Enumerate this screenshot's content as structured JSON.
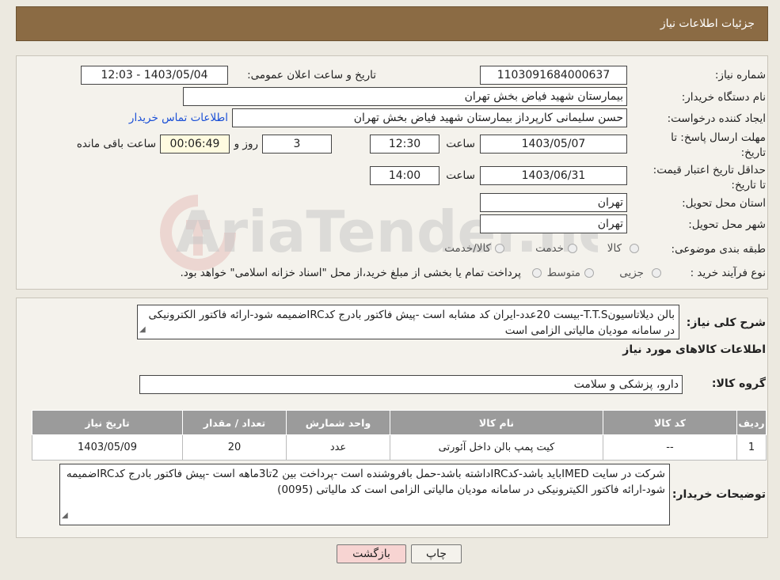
{
  "header": {
    "title": "جزئیات اطلاعات نیاز"
  },
  "form": {
    "need_number_label": "شماره نیاز:",
    "need_number": "1103091684000637",
    "announce_label": "تاریخ و ساعت اعلان عمومی:",
    "announce_value": "1403/05/04 - 12:03",
    "buyer_label": "نام دستگاه خریدار:",
    "buyer_value": "بیمارستان شهید فیاض بخش تهران",
    "creator_label": "ایجاد کننده درخواست:",
    "creator_value": "حسن سلیمانی کارپرداز بیمارستان شهید فیاض بخش تهران",
    "contact_link": "اطلاعات تماس خریدار",
    "deadline_label": "مهلت ارسال پاسخ: تا تاریخ:",
    "deadline_date": "1403/05/07",
    "time_label": "ساعت",
    "deadline_time": "12:30",
    "days_value": "3",
    "days_label": "روز و",
    "timer_value": "00:06:49",
    "remaining_label": "ساعت باقی مانده",
    "validity_label": "حداقل تاریخ اعتبار قیمت: تا تاریخ:",
    "validity_date": "1403/06/31",
    "validity_time": "14:00",
    "province_label": "استان محل تحویل:",
    "province_value": "تهران",
    "city_label": "شهر محل تحویل:",
    "city_value": "تهران",
    "category_label": "طبقه بندی موضوعی:",
    "category_options": [
      "کالا",
      "خدمت",
      "کالا/خدمت"
    ],
    "process_label": "نوع فرآیند خرید :",
    "process_options": [
      "جزیی",
      "متوسط"
    ],
    "payment_note": "پرداخت تمام یا بخشی از مبلغ خرید،از محل \"اسناد خزانه اسلامی\" خواهد بود."
  },
  "description": {
    "label": "شرح کلی نیاز:",
    "text": "بالن دیلاتاسیونT.T.S-بیست 20عدد-ایران کد مشابه است -پیش فاکتور بادرج کدIRCضمیمه شود-ارائه فاکتور الکترونیکی در سامانه مودیان مالیاتی الزامی است"
  },
  "goods": {
    "section_title": "اطلاعات کالاهای مورد نیاز",
    "group_label": "گروه کالا:",
    "group_value": "دارو، پزشکی و سلامت",
    "columns": [
      "ردیف",
      "کد کالا",
      "نام کالا",
      "واحد شمارش",
      "تعداد / مقدار",
      "تاریخ نیاز"
    ],
    "rows": [
      {
        "row": "1",
        "code": "--",
        "name": "کیت پمپ بالن داخل آئورتی",
        "unit": "عدد",
        "qty": "20",
        "date": "1403/05/09"
      }
    ]
  },
  "buyer_notes": {
    "label": "توضیحات خریدار:",
    "text": "شرکت در سایت IMEDباید باشد-کدIRCداشته باشد-حمل بافروشنده است -پرداخت بین 2تا3ماهه است -پیش فاکتور بادرج کدIRCضمیمه شود-ارائه فاکتور الکیترونیکی در سامانه مودیان مالیاتی الزامی است کد مالیاتی (0095)"
  },
  "buttons": {
    "print": "چاپ",
    "back": "بازگشت"
  },
  "colors": {
    "header_bg": "#8b6b44",
    "table_header_bg": "#9b9b9b",
    "link": "#1a4fd6",
    "back_button_bg": "#f7d4d2"
  }
}
